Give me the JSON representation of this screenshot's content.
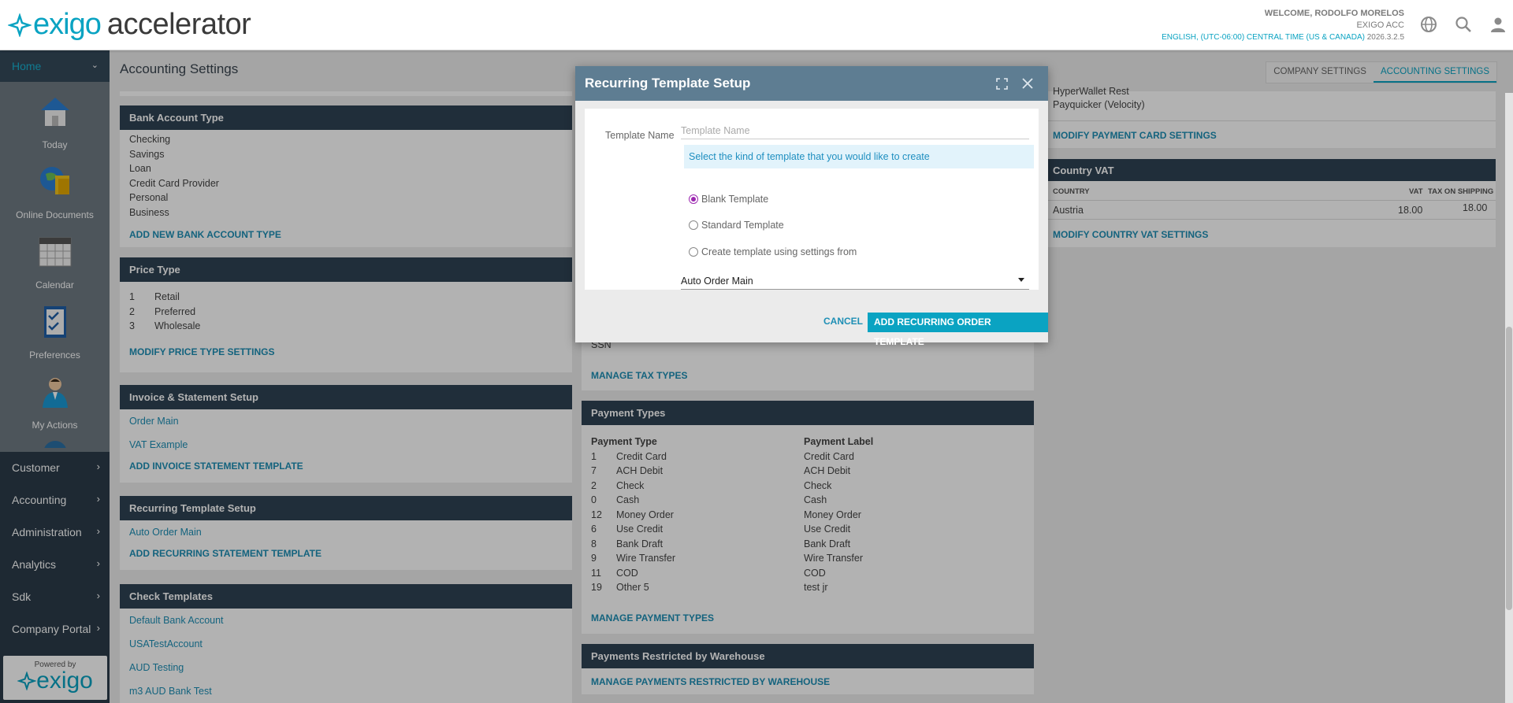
{
  "header": {
    "logo_part1": "exigo",
    "logo_part2": "accelerator",
    "welcome": "WELCOME, RODOLFO MORELOS",
    "company": "EXIGO ACC",
    "locale": "ENGLISH, (UTC-06:00) CENTRAL TIME (US & CANADA)",
    "version": "2026.3.2.5",
    "icons": [
      "globe-icon",
      "search-icon",
      "user-icon"
    ]
  },
  "sidebar": {
    "home": "Home",
    "apps": [
      {
        "label": "Today",
        "icon": "house-icon"
      },
      {
        "label": "Online Documents",
        "icon": "globe-folder-icon"
      },
      {
        "label": "Calendar",
        "icon": "calendar-icon"
      },
      {
        "label": "Preferences",
        "icon": "checklist-icon"
      },
      {
        "label": "My Actions",
        "icon": "person-icon"
      }
    ],
    "nav": [
      "Customer",
      "Accounting",
      "Administration",
      "Analytics",
      "Sdk",
      "Company Portal"
    ],
    "powered_label": "Powered by",
    "powered_logo": "exigo"
  },
  "page": {
    "title": "Accounting Settings",
    "tabs": [
      "COMPANY SETTINGS",
      "ACCOUNTING SETTINGS"
    ]
  },
  "bank_account": {
    "title": "Bank Account Type",
    "items": [
      "Checking",
      "Savings",
      "Loan",
      "Credit Card Provider",
      "Personal",
      "Business"
    ],
    "action": "ADD NEW BANK ACCOUNT TYPE"
  },
  "price_type": {
    "title": "Price Type",
    "items": [
      {
        "num": "1",
        "name": "Retail"
      },
      {
        "num": "2",
        "name": "Preferred"
      },
      {
        "num": "3",
        "name": "Wholesale"
      }
    ],
    "action": "MODIFY PRICE TYPE SETTINGS"
  },
  "invoice": {
    "title": "Invoice & Statement Setup",
    "items": [
      "Order Main",
      "VAT Example"
    ],
    "action": "ADD INVOICE STATEMENT TEMPLATE"
  },
  "recurring": {
    "title": "Recurring Template Setup",
    "items": [
      "Auto Order Main"
    ],
    "action": "ADD RECURRING STATEMENT TEMPLATE"
  },
  "check_templates": {
    "title": "Check Templates",
    "items": [
      "Default Bank Account",
      "USATestAccount",
      "AUD Testing",
      "m3 AUD Bank Test"
    ]
  },
  "tax": {
    "last_item": "SSN",
    "action": "MANAGE TAX TYPES"
  },
  "payment_types": {
    "title": "Payment Types",
    "col1": "Payment Type",
    "col2": "Payment Label",
    "rows": [
      {
        "num": "1",
        "type": "Credit Card",
        "label": "Credit Card"
      },
      {
        "num": "7",
        "type": "ACH Debit",
        "label": "ACH Debit"
      },
      {
        "num": "2",
        "type": "Check",
        "label": "Check"
      },
      {
        "num": "0",
        "type": "Cash",
        "label": "Cash"
      },
      {
        "num": "12",
        "type": "Money Order",
        "label": "Money Order"
      },
      {
        "num": "6",
        "type": "Use Credit",
        "label": "Use Credit"
      },
      {
        "num": "8",
        "type": "Bank Draft",
        "label": "Bank Draft"
      },
      {
        "num": "9",
        "type": "Wire Transfer",
        "label": "Wire Transfer"
      },
      {
        "num": "11",
        "type": "COD",
        "label": "COD"
      },
      {
        "num": "19",
        "type": "Other 5",
        "label": "test jr"
      }
    ],
    "action": "MANAGE PAYMENT TYPES"
  },
  "payments_restricted": {
    "title": "Payments Restricted by Warehouse",
    "action": "MANAGE PAYMENTS RESTRICTED BY WAREHOUSE"
  },
  "payment_card": {
    "items": [
      "HyperWallet Rest",
      "Payquicker (Velocity)"
    ],
    "action": "MODIFY PAYMENT CARD SETTINGS"
  },
  "country_vat": {
    "title": "Country VAT",
    "col_country": "COUNTRY",
    "col_vat": "VAT",
    "col_shipping": "TAX ON SHIPPING",
    "rows": [
      {
        "country": "Austria",
        "vat": "18.00",
        "shipping": "18.00"
      }
    ],
    "action": "MODIFY COUNTRY VAT SETTINGS"
  },
  "modal": {
    "title": "Recurring Template Setup",
    "name_label": "Template Name",
    "name_placeholder": "Template Name",
    "name_value": "",
    "info": "Select the kind of template that you would like to create",
    "options": [
      "Blank Template",
      "Standard Template",
      "Create template using settings from"
    ],
    "selected_option": "Blank Template",
    "source_select": "Auto Order Main",
    "cancel": "CANCEL",
    "submit": "ADD RECURRING ORDER TEMPLATE"
  },
  "colors": {
    "accent": "#0aa3c2",
    "panel_header": "#2f4354",
    "modal_header": "#5e7d92",
    "sidebar": "#2b3c4a",
    "radio_checked": "#9c27b0"
  }
}
